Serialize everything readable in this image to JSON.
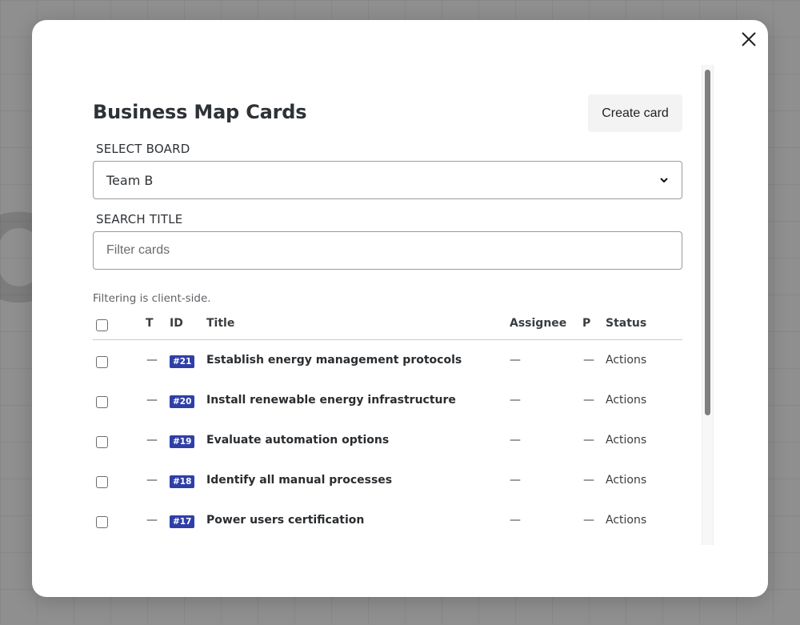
{
  "background": {
    "glyph": "O"
  },
  "modal": {
    "title": "Business Map Cards",
    "create_button_label": "Create card",
    "board_label": "SELECT BOARD",
    "board_selected": "Team B",
    "search_label": "SEARCH TITLE",
    "search_placeholder": "Filter cards",
    "search_value": "",
    "help_text": "Filtering is client-side."
  },
  "table": {
    "headers": {
      "type": "T",
      "id": "ID",
      "title": "Title",
      "assignee": "Assignee",
      "priority": "P",
      "status": "Status"
    },
    "rows": [
      {
        "type": "—",
        "id": "#21",
        "title": "Establish energy management protocols",
        "assignee": "—",
        "priority": "—",
        "status": "Actions"
      },
      {
        "type": "—",
        "id": "#20",
        "title": "Install renewable energy infrastructure",
        "assignee": "—",
        "priority": "—",
        "status": "Actions"
      },
      {
        "type": "—",
        "id": "#19",
        "title": "Evaluate automation options",
        "assignee": "—",
        "priority": "—",
        "status": "Actions"
      },
      {
        "type": "—",
        "id": "#18",
        "title": "Identify all manual processes",
        "assignee": "—",
        "priority": "—",
        "status": "Actions"
      },
      {
        "type": "—",
        "id": "#17",
        "title": "Power users certification",
        "assignee": "—",
        "priority": "—",
        "status": "Actions"
      }
    ]
  },
  "colors": {
    "id_badge": "#2f3fa8",
    "overlay": "#8f8f8f",
    "modal_bg": "#ffffff"
  },
  "icons": {
    "close": "close-icon",
    "select": "chevron-down-icon"
  }
}
